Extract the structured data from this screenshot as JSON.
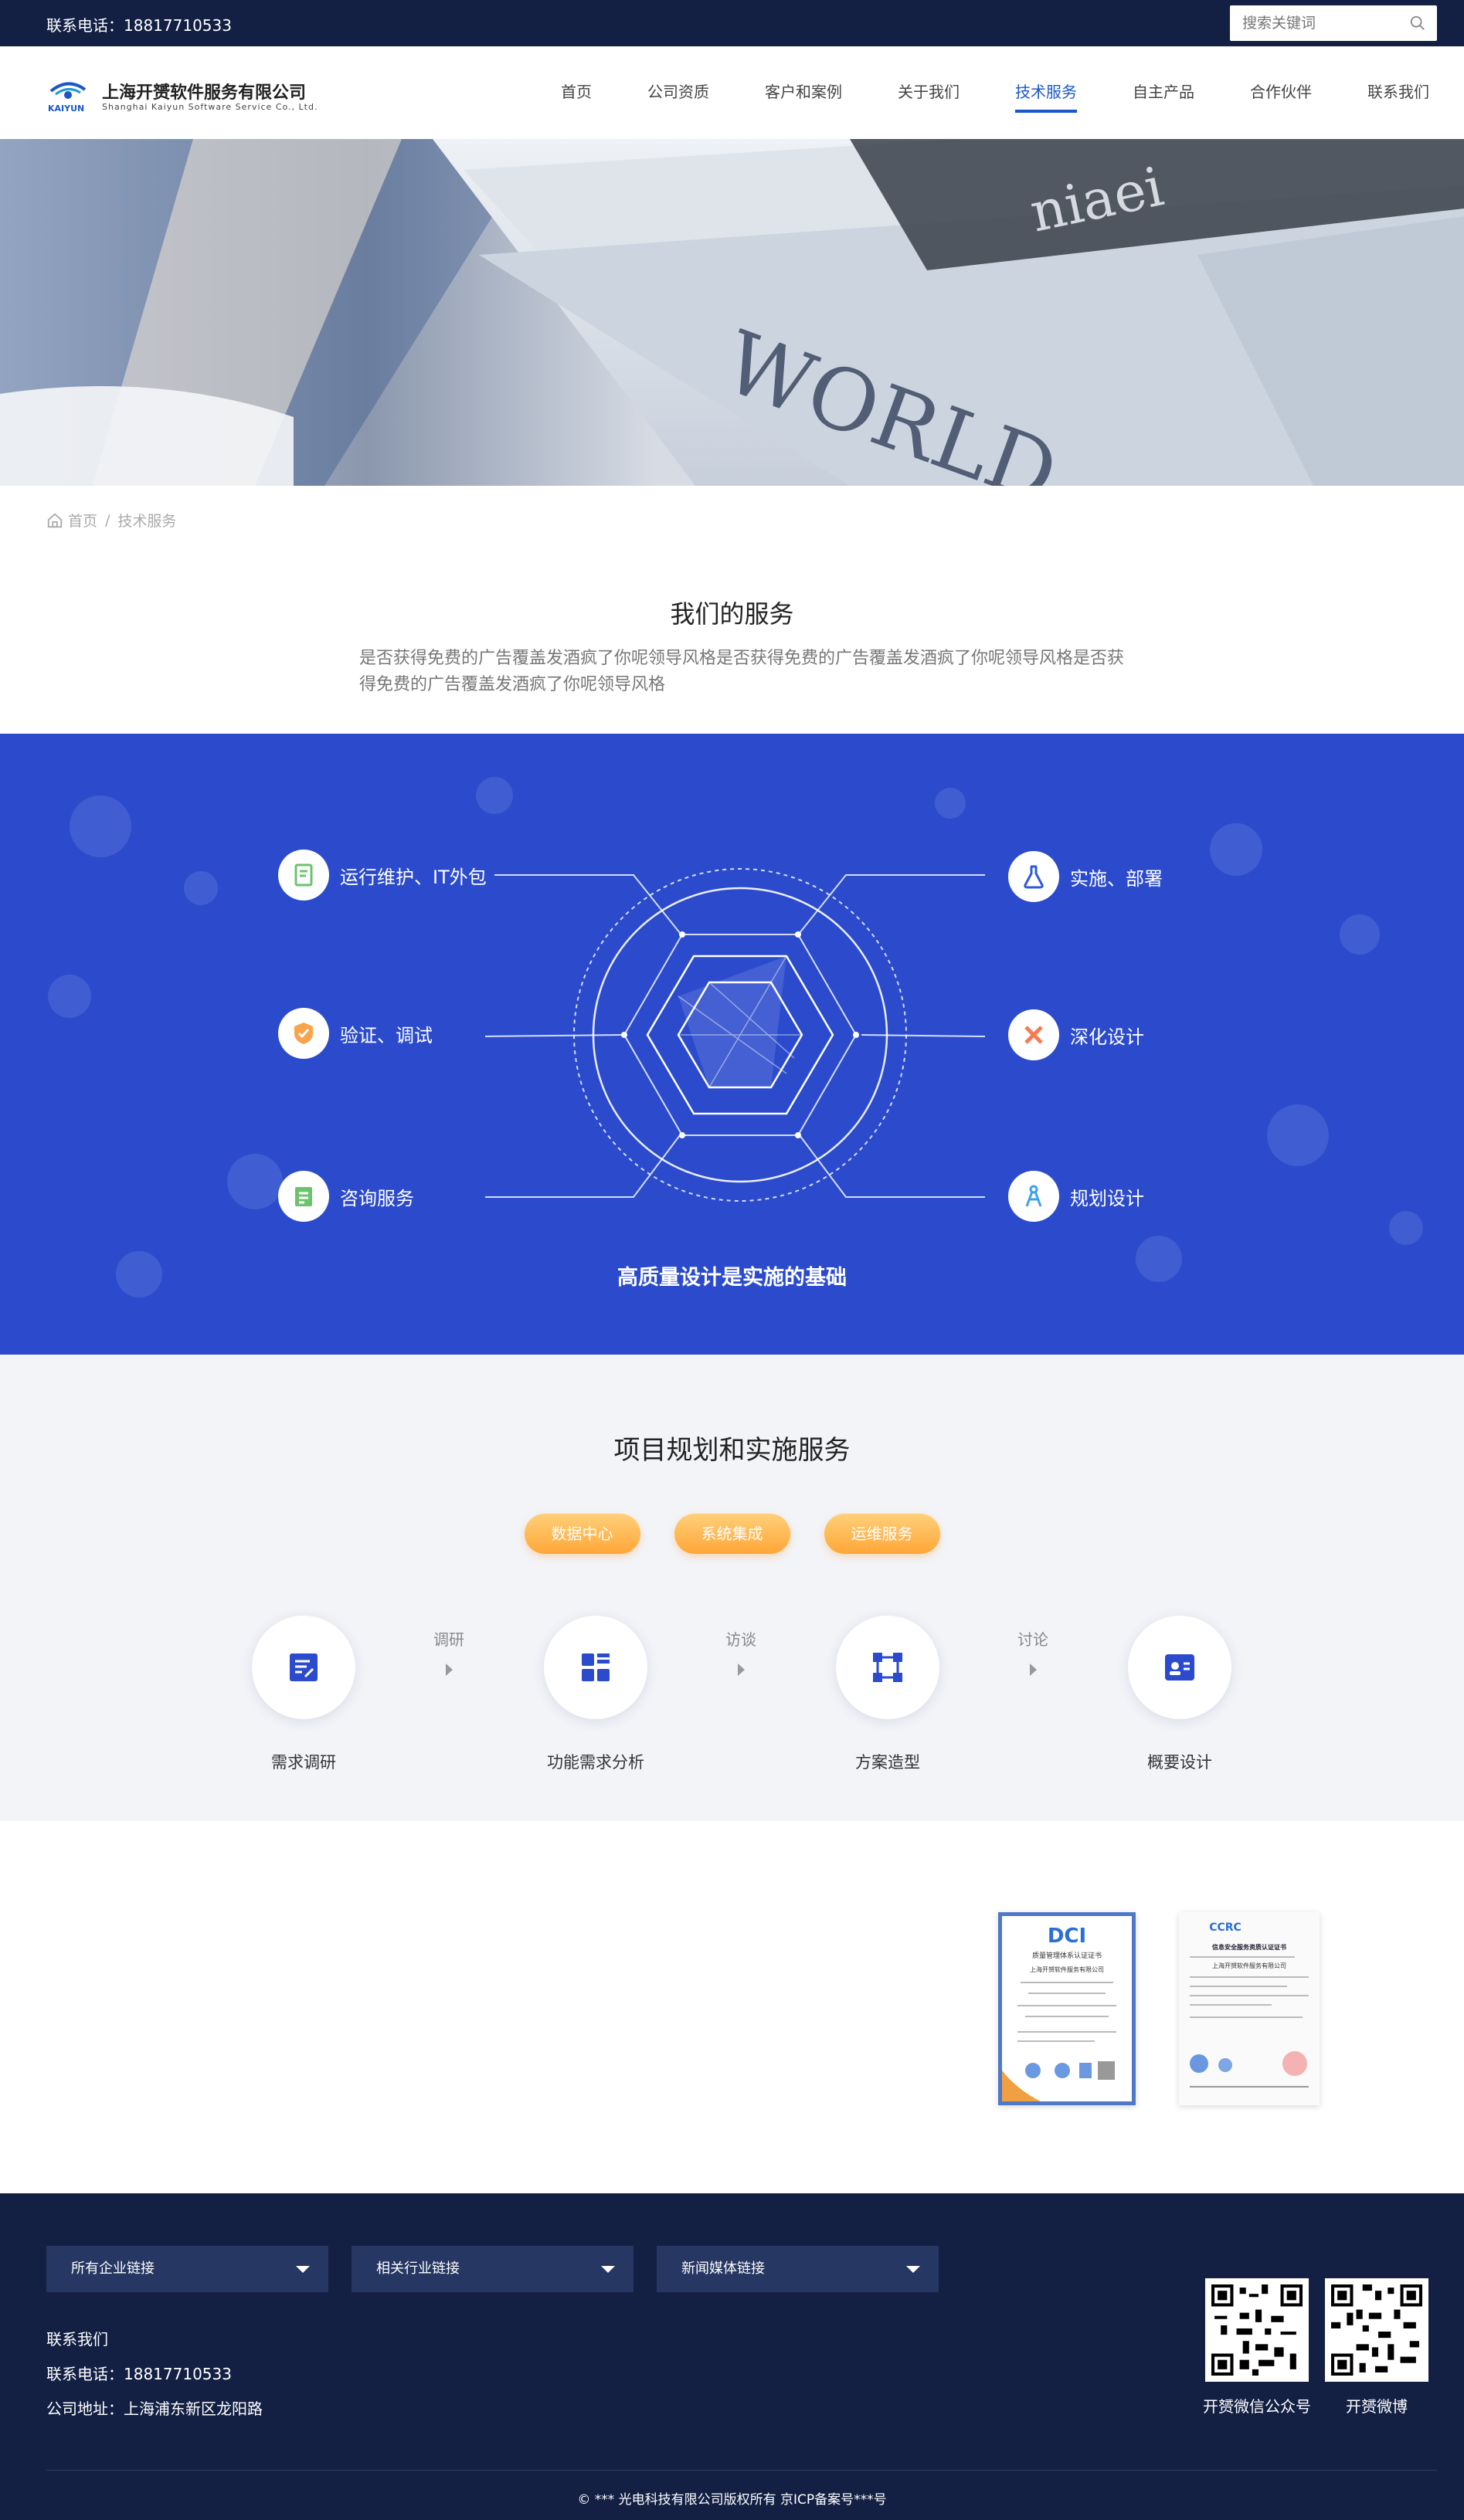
{
  "topbar": {
    "phone": "联系电话：18817710533",
    "search_placeholder": "搜索关键词"
  },
  "logo": {
    "cn": "上海开赟软件服务有限公司",
    "en": "Shanghai Kaiyun Software Service Co., Ltd.",
    "mark_text": "KAIYUN"
  },
  "nav": [
    {
      "label": "首页"
    },
    {
      "label": "公司资质"
    },
    {
      "label": "客户和案例"
    },
    {
      "label": "关于我们"
    },
    {
      "label": "技术服务",
      "active": true
    },
    {
      "label": "自主产品"
    },
    {
      "label": "合作伙伴"
    },
    {
      "label": "联系我们"
    }
  ],
  "breadcrumb": {
    "home": "首页",
    "sep": "/",
    "current": "技术服务"
  },
  "services": {
    "title": "我们的服务",
    "desc": "是否获得免费的广告覆盖发酒疯了你呢领导风格是否获得免费的广告覆盖发酒疯了你呢领导风格是否获得免费的广告覆盖发酒疯了你呢领导风格",
    "features": [
      {
        "label": "运行维护、IT外包",
        "icon": "document-check-icon",
        "color": "#6cc36e"
      },
      {
        "label": "验证、调试",
        "icon": "shield-check-icon",
        "color": "#f7a44a"
      },
      {
        "label": "咨询服务",
        "icon": "consult-doc-icon",
        "color": "#6cc36e"
      },
      {
        "label": "实施、部署",
        "icon": "flask-icon",
        "color": "#2e59d9"
      },
      {
        "label": "深化设计",
        "icon": "cross-tools-icon",
        "color": "#f87a52"
      },
      {
        "label": "规划设计",
        "icon": "compass-icon",
        "color": "#3ca2e8"
      }
    ],
    "caption": "高质量设计是实施的基础"
  },
  "project": {
    "title": "项目规划和实施服务",
    "tabs": [
      "数据中心",
      "系统集成",
      "运维服务"
    ],
    "steps": [
      {
        "label": "需求调研",
        "icon": "edit-document-icon"
      },
      {
        "label": "功能需求分析",
        "icon": "grid-list-icon"
      },
      {
        "label": "方案造型",
        "icon": "network-nodes-icon"
      },
      {
        "label": "概要设计",
        "icon": "id-card-icon"
      }
    ],
    "arrows": [
      "调研",
      "访谈",
      "讨论"
    ]
  },
  "certs": [
    {
      "brand": "DCI",
      "title": "质量管理体系认证证书",
      "line": "上海开赟软件服务有限公司"
    },
    {
      "brand": "CCRC",
      "title": "信息安全服务资质认证证书",
      "line": "上海开赟软件服务有限公司"
    }
  ],
  "footer": {
    "selects": [
      "所有企业链接",
      "相关行业链接",
      "新闻媒体链接"
    ],
    "contact_title": "联系我们",
    "phone": "联系电话：18817710533",
    "address": "公司地址：上海浦东新区龙阳路",
    "qr": [
      {
        "label": "开赟微信公众号"
      },
      {
        "label": "开赟微博"
      }
    ],
    "copyright": "© *** 光电科技有限公司版权所有   京ICP备案号***号"
  },
  "colors": {
    "navy": "#132044",
    "accent": "#1a57c8",
    "blue_band": "#2b4bcc",
    "orange": "#ffa637"
  }
}
